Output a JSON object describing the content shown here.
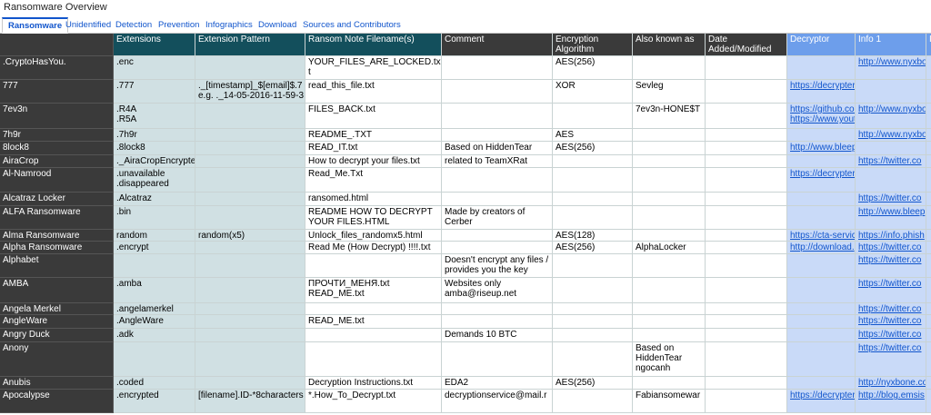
{
  "window": {
    "title": "Ransomware Overview"
  },
  "tabs": [
    {
      "label": "Ransomware",
      "active": true
    },
    {
      "label": "Unidentified"
    },
    {
      "label": "Detection"
    },
    {
      "label": "Prevention"
    },
    {
      "label": "Infographics"
    },
    {
      "label": "Download"
    },
    {
      "label": "Sources and Contributors"
    }
  ],
  "columns": [
    "",
    "Extensions",
    "Extension Pattern",
    "Ransom Note Filename(s)",
    "Comment",
    "Encryption\nAlgorithm",
    "Also known as",
    "Date\nAdded/Modified",
    "Decryptor",
    "Info 1",
    "I"
  ],
  "rows": [
    {
      "name": ".CryptoHasYou.",
      "ext": ".enc",
      "pattern": "",
      "note": "YOUR_FILES_ARE_LOCKED.tx\nt",
      "comment": "",
      "algo": "AES(256)",
      "aka": "",
      "date": "",
      "decryptor": "",
      "info1": "http://www.nyxbo",
      "i": ""
    },
    {
      "name": "777",
      "ext": ".777",
      "pattern": "._[timestamp]_$[email]$.7\ne.g. ._14-05-2016-11-59-3",
      "note": "read_this_file.txt",
      "comment": "",
      "algo": "XOR",
      "aka": "Sevleg",
      "date": "",
      "decryptor": "https://decrypter.",
      "info1": "",
      "i": ""
    },
    {
      "name": "7ev3n",
      "ext": ".R4A\n.R5A",
      "pattern": "",
      "note": "FILES_BACK.txt",
      "comment": "",
      "algo": "",
      "aka": "7ev3n-HONE$T",
      "date": "",
      "decryptor": "https://github.cor\nhttps://www.yout",
      "info1": "http://www.nyxbo",
      "i": ""
    },
    {
      "name": "7h9r",
      "ext": ".7h9r",
      "pattern": "",
      "note": "README_.TXT",
      "comment": "",
      "algo": "AES",
      "aka": "",
      "date": "",
      "decryptor": "",
      "info1": "http://www.nyxbo",
      "i": ""
    },
    {
      "name": "8lock8",
      "ext": ".8lock8",
      "pattern": "",
      "note": "READ_IT.txt",
      "comment": "Based on HiddenTear",
      "algo": "AES(256)",
      "aka": "",
      "date": "",
      "decryptor": "http://www.bleep",
      "info1": "",
      "i": ""
    },
    {
      "name": "AiraCrop",
      "ext": "._AiraCropEncrypted",
      "pattern": "",
      "note": "How to decrypt your files.txt",
      "comment": "related to TeamXRat",
      "algo": "",
      "aka": "",
      "date": "",
      "decryptor": "",
      "info1": "https://twitter.co",
      "i": ""
    },
    {
      "name": "Al-Namrood",
      "ext": ".unavailable\n.disappeared",
      "pattern": "",
      "note": "Read_Me.Txt",
      "comment": "",
      "algo": "",
      "aka": "",
      "date": "",
      "decryptor": "https://decrypter.",
      "info1": "",
      "i": ""
    },
    {
      "name": "Alcatraz Locker",
      "ext": ".Alcatraz",
      "pattern": "",
      "note": "ransomed.html",
      "comment": "",
      "algo": "",
      "aka": "",
      "date": "",
      "decryptor": "",
      "info1": "https://twitter.co",
      "i": ""
    },
    {
      "name": "ALFA Ransomware",
      "ext": ".bin",
      "pattern": "",
      "note": "README HOW TO DECRYPT\nYOUR FILES.HTML",
      "comment": "Made by creators of\nCerber",
      "algo": "",
      "aka": "",
      "date": "",
      "decryptor": "",
      "info1": "http://www.bleep",
      "i": ""
    },
    {
      "name": "Alma Ransomware",
      "ext": "random",
      "pattern": "random(x5)",
      "note": "Unlock_files_randomx5.html",
      "comment": "",
      "algo": "AES(128)",
      "aka": "",
      "date": "",
      "decryptor": "https://cta-servic",
      "info1": "https://info.phish",
      "i": ""
    },
    {
      "name": "Alpha Ransomware",
      "ext": ".encrypt",
      "pattern": "",
      "note": "Read Me (How Decrypt) !!!!.txt",
      "comment": "",
      "algo": "AES(256)",
      "aka": "AlphaLocker",
      "date": "",
      "decryptor": "http://download.",
      "info1": "https://twitter.co",
      "i": ""
    },
    {
      "name": "Alphabet",
      "ext": "",
      "pattern": "",
      "note": "",
      "comment": "Doesn't encrypt any files /\nprovides you the key",
      "algo": "",
      "aka": "",
      "date": "",
      "decryptor": "",
      "info1": "https://twitter.co",
      "i": ""
    },
    {
      "name": "AMBA",
      "ext": ".amba",
      "pattern": "",
      "note": "ПРОЧТИ_МЕНЯ.txt\nREAD_ME.txt",
      "comment": "Websites only\namba@riseup.net",
      "algo": "",
      "aka": "",
      "date": "",
      "decryptor": "",
      "info1": "https://twitter.co",
      "i": ""
    },
    {
      "name": "Angela Merkel",
      "ext": ".angelamerkel",
      "pattern": "",
      "note": "",
      "comment": "",
      "algo": "",
      "aka": "",
      "date": "",
      "decryptor": "",
      "info1": "https://twitter.co",
      "i": ""
    },
    {
      "name": "AngleWare",
      "ext": ".AngleWare",
      "pattern": "",
      "note": "READ_ME.txt",
      "comment": "",
      "algo": "",
      "aka": "",
      "date": "",
      "decryptor": "",
      "info1": "https://twitter.co",
      "i": ""
    },
    {
      "name": "Angry Duck",
      "ext": ".adk",
      "pattern": "",
      "note": "",
      "comment": "Demands 10 BTC",
      "algo": "",
      "aka": "",
      "date": "",
      "decryptor": "",
      "info1": "https://twitter.co",
      "i": ""
    },
    {
      "name": "Anony",
      "ext": "",
      "pattern": "",
      "note": "",
      "comment": "",
      "algo": "",
      "aka": "Based on\nHiddenTear\nngocanh",
      "date": "",
      "decryptor": "",
      "info1": "https://twitter.co",
      "i": ""
    },
    {
      "name": "Anubis",
      "ext": ".coded",
      "pattern": "",
      "note": "Decryption Instructions.txt",
      "comment": "EDA2",
      "algo": "AES(256)",
      "aka": "",
      "date": "",
      "decryptor": "",
      "info1": "http://nyxbone.co",
      "i": ""
    },
    {
      "name": "Apocalypse",
      "ext": ".encrypted",
      "pattern": "[filename].ID-*8characters",
      "note": "*.How_To_Decrypt.txt",
      "comment": "decryptionservice@mail.r",
      "algo": "",
      "aka": "Fabiansomewar",
      "date": "",
      "decryptor": "https://decrypter.",
      "info1": "http://blog.emsis",
      "i": ""
    }
  ]
}
